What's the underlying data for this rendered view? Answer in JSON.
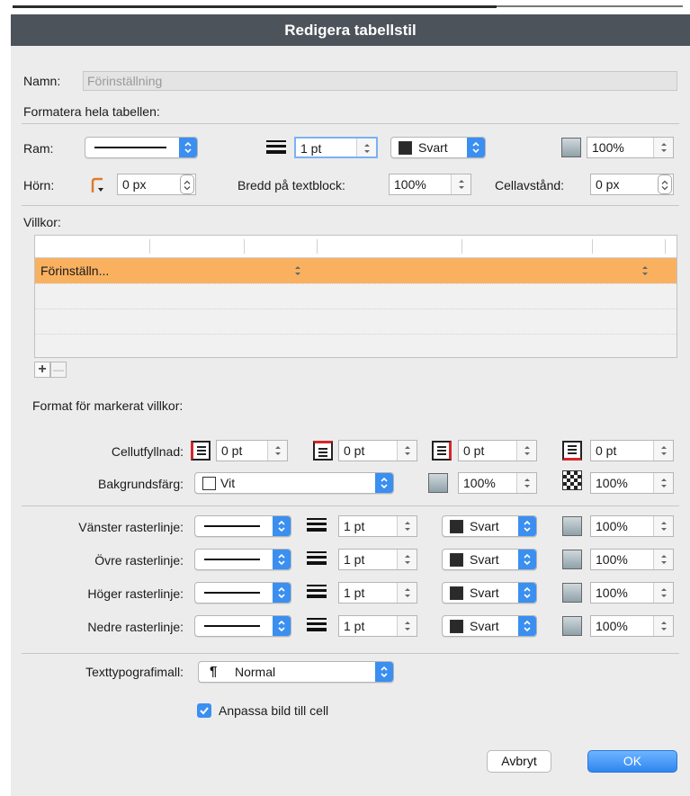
{
  "dialog": {
    "title": "Redigera tabellstil"
  },
  "name_field": {
    "label": "Namn:",
    "placeholder": "Förinställning"
  },
  "whole_table": {
    "heading": "Formatera hela tabellen:",
    "frame_label": "Ram:",
    "frame_weight": "1 pt",
    "frame_color": "Svart",
    "frame_tint": "100%",
    "corner_label": "Hörn:",
    "corner_radius": "0 px",
    "textblock_width_label": "Bredd på textblock:",
    "textblock_width": "100%",
    "cell_spacing_label": "Cellavstånd:",
    "cell_spacing": "0 px"
  },
  "conditions": {
    "heading": "Villkor:",
    "rows": [
      {
        "label": "Förinställn...",
        "selected": true
      }
    ],
    "add_symbol": "+",
    "remove_symbol": "—"
  },
  "selected_format": {
    "heading": "Format för markerat villkor:",
    "cell_padding_label": "Cellutfyllnad:",
    "paddings": [
      "0 pt",
      "0 pt",
      "0 pt",
      "0 pt"
    ],
    "background_label": "Bakgrundsfärg:",
    "background_color": "Vit",
    "background_tint": "100%",
    "background_opacity": "100%"
  },
  "gridlines": [
    {
      "label": "Vänster rasterlinje:",
      "weight": "1 pt",
      "color": "Svart",
      "tint": "100%"
    },
    {
      "label": "Övre rasterlinje:",
      "weight": "1 pt",
      "color": "Svart",
      "tint": "100%"
    },
    {
      "label": "Höger rasterlinje:",
      "weight": "1 pt",
      "color": "Svart",
      "tint": "100%"
    },
    {
      "label": "Nedre rasterlinje:",
      "weight": "1 pt",
      "color": "Svart",
      "tint": "100%"
    }
  ],
  "typography": {
    "label": "Texttypografimall:",
    "symbol": "¶",
    "value": "Normal"
  },
  "fit_image": {
    "label": "Anpassa bild till cell",
    "checked": true
  },
  "buttons": {
    "cancel": "Avbryt",
    "ok": "OK"
  },
  "colors": {
    "accent": "#3a8ff0",
    "selection": "#f9b160",
    "titlebar": "#4d535a",
    "corner_icon": "#e07a2a",
    "padding_edge": "#d6262a"
  },
  "icons": {
    "popup_arrows": "chevron-updown-icon",
    "stepper_arrows": "stepper-arrows-icon",
    "line_weight": "line-weight-icon",
    "tint": "tint-icon",
    "opacity": "opacity-icon",
    "corner": "corner-icon",
    "padding": [
      "padding-left-icon",
      "padding-top-icon",
      "padding-right-icon",
      "padding-bottom-icon"
    ],
    "paragraph": "pilcrow-icon",
    "checkmark": "checkmark-icon"
  }
}
